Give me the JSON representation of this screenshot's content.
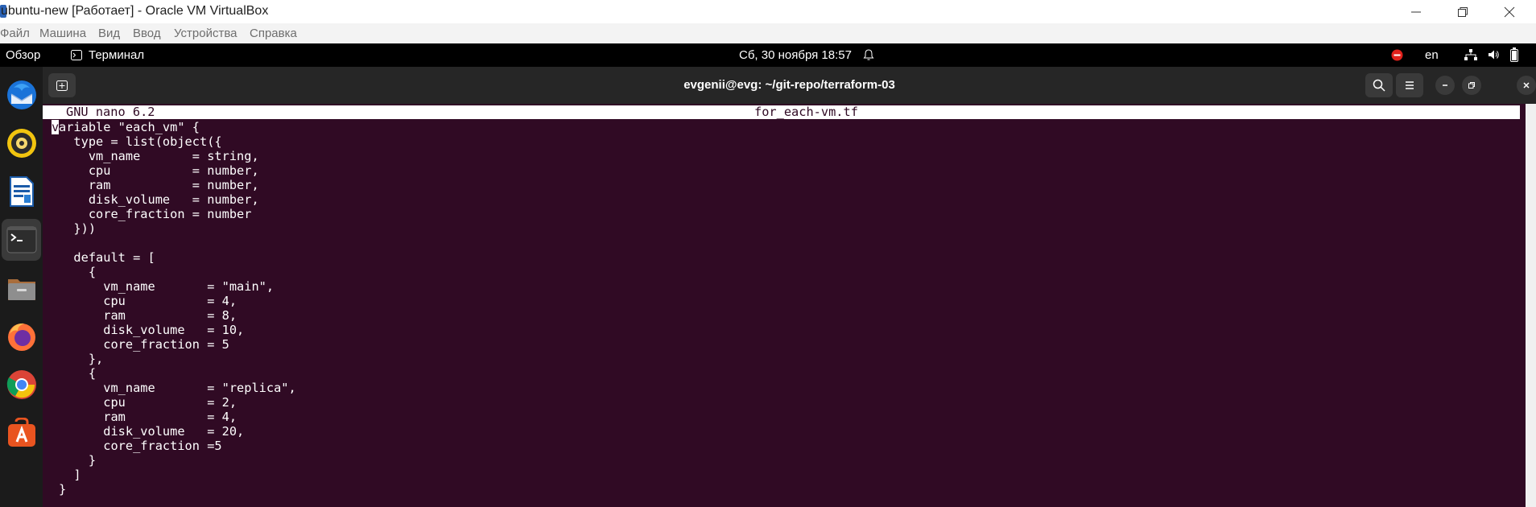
{
  "host": {
    "title": "ubuntu-new [Работает] - Oracle VM VirtualBox",
    "menu": [
      "Файл",
      "Машина",
      "Вид",
      "Ввод",
      "Устройства",
      "Справка"
    ]
  },
  "topbar": {
    "overview": "Обзор",
    "app_name": "Терминал",
    "datetime": "Сб, 30 ноября  18:57",
    "lang": "en"
  },
  "dock": {
    "items": [
      "thunderbird-icon",
      "rhythmbox-icon",
      "libreoffice-writer-icon",
      "terminal-icon",
      "files-icon",
      "firefox-icon",
      "chrome-icon",
      "app-center-icon"
    ]
  },
  "terminal": {
    "title": "evgenii@evg: ~/git-repo/terraform-03",
    "nano_version": "GNU nano 6.2",
    "filename": "for_each-vm.tf",
    "cursor_char": "v",
    "lines": [
      "ariable \"each_vm\" {",
      "  type = list(object({",
      "    vm_name       = string,",
      "    cpu           = number,",
      "    ram           = number,",
      "    disk_volume   = number,",
      "    core_fraction = number",
      "  }))",
      "",
      "  default = [",
      "    {",
      "      vm_name       = \"main\",",
      "      cpu           = 4,",
      "      ram           = 8,",
      "      disk_volume   = 10,",
      "      core_fraction = 5",
      "    },",
      "    {",
      "      vm_name       = \"replica\",",
      "      cpu           = 2,",
      "      ram           = 4,",
      "      disk_volume   = 20,",
      "      core_fraction =5",
      "    }",
      "  ]",
      "}"
    ]
  },
  "colors": {
    "terminal_bg": "#300a24",
    "header_bg": "#262626",
    "accent_red": "#e0211b"
  }
}
